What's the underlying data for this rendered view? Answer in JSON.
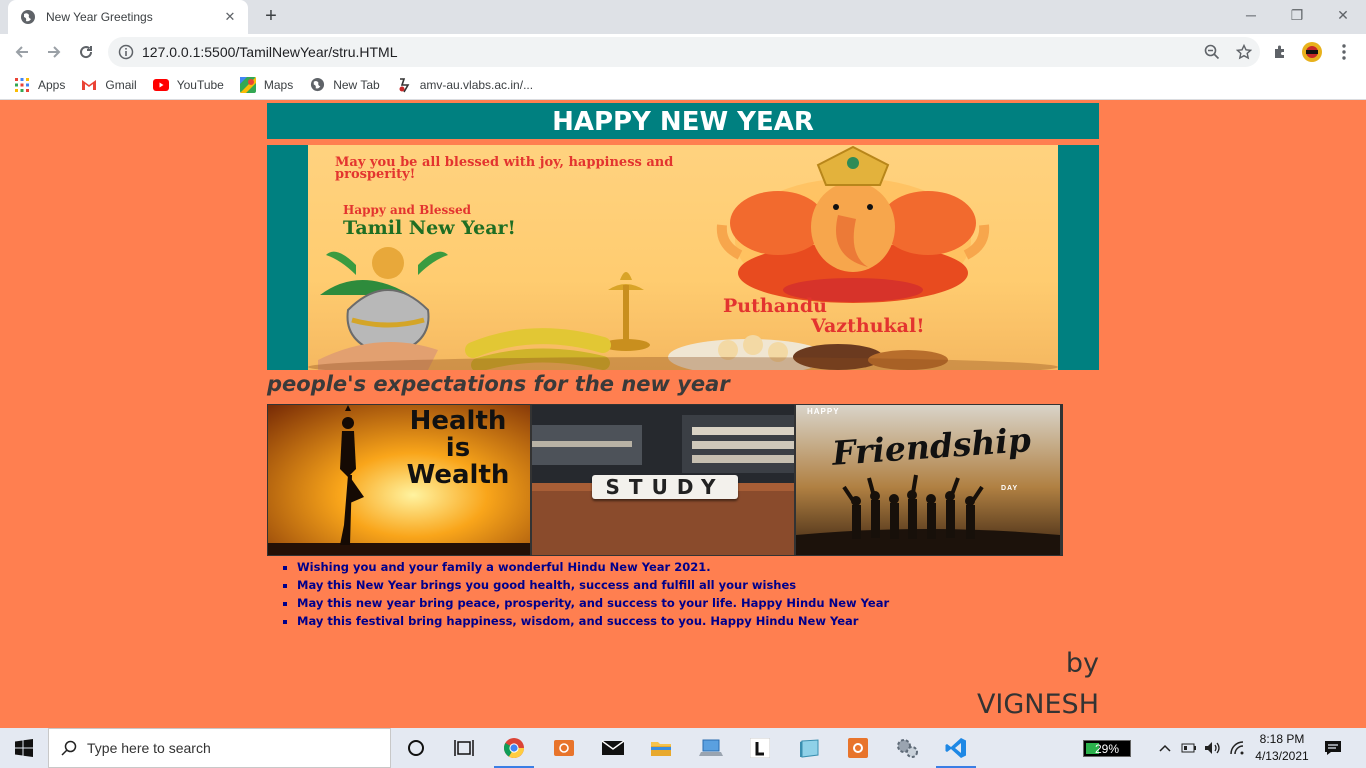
{
  "browser": {
    "tab_title": "New Year Greetings",
    "url": "127.0.0.1:5500/TamilNewYear/stru.HTML",
    "bookmarks": [
      {
        "label": "Apps",
        "icon": "apps-grid-icon"
      },
      {
        "label": "Gmail",
        "icon": "gmail-icon"
      },
      {
        "label": "YouTube",
        "icon": "youtube-icon"
      },
      {
        "label": "Maps",
        "icon": "maps-icon"
      },
      {
        "label": "New Tab",
        "icon": "globe-icon"
      },
      {
        "label": "amv-au.vlabs.ac.in/...",
        "icon": "vlabs-icon"
      }
    ]
  },
  "page": {
    "title": "HAPPY NEW YEAR",
    "hero": {
      "line1": "May you be all blessed with joy, happiness and prosperity!",
      "line2": "Happy and Blessed",
      "line3": "Tamil New Year!",
      "wish1": "Puthandu",
      "wish2": "Vazthukal!"
    },
    "subheading": "people's expectations for the new year",
    "gallery": [
      {
        "caption_a": "Health",
        "caption_b": "is",
        "caption_c": "Wealth"
      },
      {
        "caption": "STUDY"
      },
      {
        "caption_small": "HAPPY",
        "caption": "Friendship",
        "caption_tail": "DAY"
      }
    ],
    "wishes": [
      "Wishing you and your family a wonderful Hindu New Year 2021.",
      "May this New Year brings you good health, success and fulfill all your wishes",
      "May this new year bring peace, prosperity, and success to your life. Happy Hindu New Year",
      "May this festival bring happiness, wisdom, and success to you. Happy Hindu New Year"
    ],
    "by_label": "by",
    "author": "VIGNESH"
  },
  "taskbar": {
    "search_placeholder": "Type here to search",
    "battery": "29%",
    "battery_level": 0.29,
    "time": "8:18 PM",
    "date": "4/13/2021"
  },
  "colors": {
    "page_bg": "#ff7f50",
    "teal": "#008080",
    "wish_text": "#00008b"
  }
}
